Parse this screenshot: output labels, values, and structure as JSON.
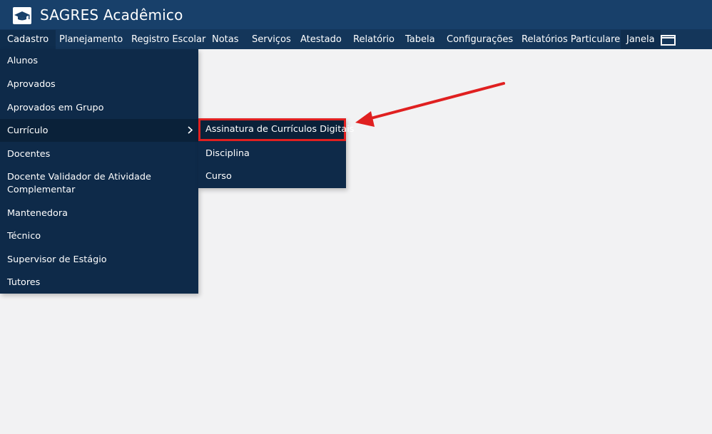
{
  "app": {
    "title": "SAGRES Acadêmico",
    "icon": "graduation-cap-icon"
  },
  "menubar": {
    "items": [
      {
        "label": "Cadastro",
        "active": true
      },
      {
        "label": "Planejamento"
      },
      {
        "label": "Registro Escolar"
      },
      {
        "label": "Notas"
      },
      {
        "label": "Serviços"
      },
      {
        "label": "Atestado"
      },
      {
        "label": "Relatório"
      },
      {
        "label": "Tabela"
      },
      {
        "label": "Configurações"
      },
      {
        "label": "Relatórios Particulares"
      },
      {
        "label": "Janela"
      }
    ],
    "window_icon": "window-switch-icon"
  },
  "cadastro_menu": {
    "items": [
      {
        "label": "Alunos"
      },
      {
        "label": "Aprovados"
      },
      {
        "label": "Aprovados em Grupo"
      },
      {
        "label": "Currículo",
        "has_submenu": true,
        "hovered": true
      },
      {
        "label": "Docentes"
      },
      {
        "label": "Docente Validador de Atividade Complementar"
      },
      {
        "label": "Mantenedora"
      },
      {
        "label": "Técnico"
      },
      {
        "label": "Supervisor de Estágio"
      },
      {
        "label": "Tutores"
      }
    ]
  },
  "curriculo_submenu": {
    "items": [
      {
        "label": "Assinatura de Currículos Digitais",
        "highlighted": true
      },
      {
        "label": "Disciplina"
      },
      {
        "label": "Curso"
      }
    ]
  },
  "colors": {
    "titlebar": "#18406a",
    "menubar": "#14365a",
    "menu_panel": "#0e2a49",
    "hover": "#0a2139",
    "highlight_border": "#e02020",
    "annotation_arrow": "#e02020"
  }
}
